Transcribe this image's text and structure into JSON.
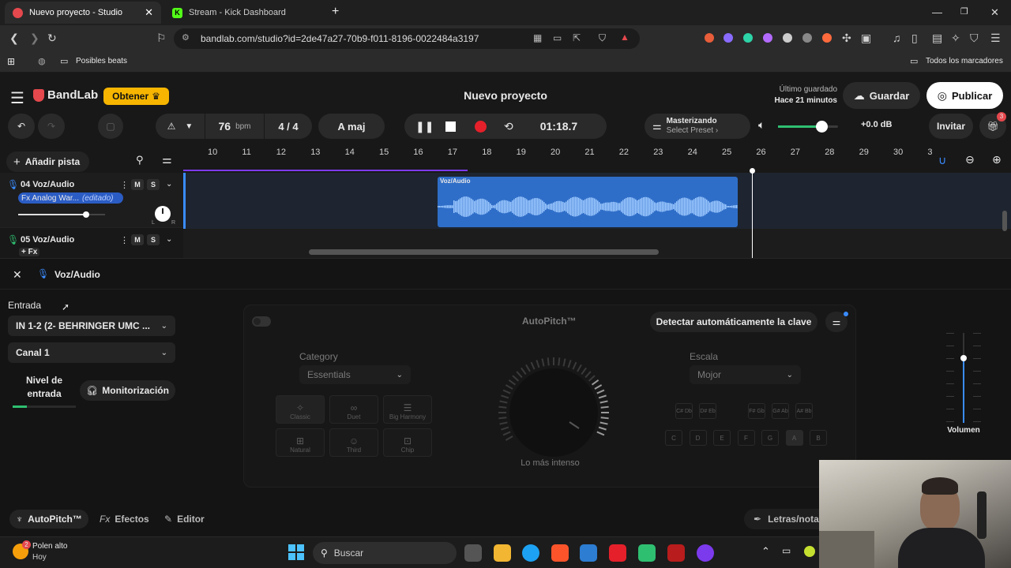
{
  "browser": {
    "tabs": [
      {
        "label": "Nuevo proyecto - Studio",
        "color": "#e5484d"
      },
      {
        "label": "Stream - Kick Dashboard",
        "color": "#53fc18"
      }
    ],
    "new_tab": "+",
    "url": "bandlab.com/studio?id=2de47a27-70b9-f011-8196-0022484a3197",
    "bookmarks": {
      "folder": "Posibles beats",
      "all": "Todos los marcadores"
    }
  },
  "app": {
    "logo": "BandLab",
    "get_button": "Obtener",
    "project_title": "Nuevo proyecto",
    "last_saved_label": "Último guardado",
    "last_saved_time": "Hace 21 minutos",
    "save": "Guardar",
    "publish": "Publicar",
    "bpm_value": "76",
    "bpm_unit": "bpm",
    "time_sig": "4 / 4",
    "key": "A maj",
    "time": "01:18.7",
    "mastering_title": "Masterizando",
    "mastering_preset": "Select Preset ›",
    "volume_db": "+0.0 dB",
    "master_volume": 0.72,
    "invite": "Invitar",
    "gift_badge": "3",
    "add_track": "Añadir pista"
  },
  "ruler": [
    "10",
    "11",
    "12",
    "13",
    "14",
    "15",
    "16",
    "17",
    "18",
    "19",
    "20",
    "21",
    "22",
    "23",
    "24",
    "25",
    "26",
    "27",
    "28",
    "29",
    "30",
    "3"
  ],
  "tracks": [
    {
      "name": "04  Voz/Audio",
      "fx": "Fx Analog War...",
      "fx_edited": "(editado)",
      "mute": "M",
      "solo": "S",
      "volume": 0.78
    },
    {
      "name": "05  Voz/Audio",
      "fx": "+ Fx",
      "mute": "M",
      "solo": "S"
    }
  ],
  "clip_label": "Voz/Audio",
  "panel": {
    "track_name": "Voz/Audio",
    "input_label": "Entrada",
    "input_device": "IN 1-2 (2- BEHRINGER UMC ...",
    "channel": "Canal 1",
    "input_level_label": "Nivel de entrada",
    "monitor": "Monitorización",
    "autopitch_title": "AutoPitch™",
    "detect_key": "Detectar automáticamente la clave",
    "category_label": "Category",
    "category_value": "Essentials",
    "scale_label": "Escala",
    "scale_value": "Mojor",
    "presets": [
      "Classic",
      "Duet",
      "Big Harmony",
      "Natural",
      "Third",
      "Chip"
    ],
    "knob_label": "Lo más intenso",
    "keys_top": [
      "C# Db",
      "D# Eb",
      "F# Gb",
      "G# Ab",
      "A# Bb"
    ],
    "keys_bottom": [
      "C",
      "D",
      "E",
      "F",
      "G",
      "A",
      "B"
    ],
    "volume_label": "Volumen",
    "tabs": [
      "AutoPitch™",
      "Efectos",
      "Editor"
    ],
    "lyrics_tab": "Letras/nota"
  },
  "taskbar": {
    "weather_title": "Polen alto",
    "weather_sub": "Hoy",
    "weather_badge": "2",
    "search": "Buscar"
  }
}
